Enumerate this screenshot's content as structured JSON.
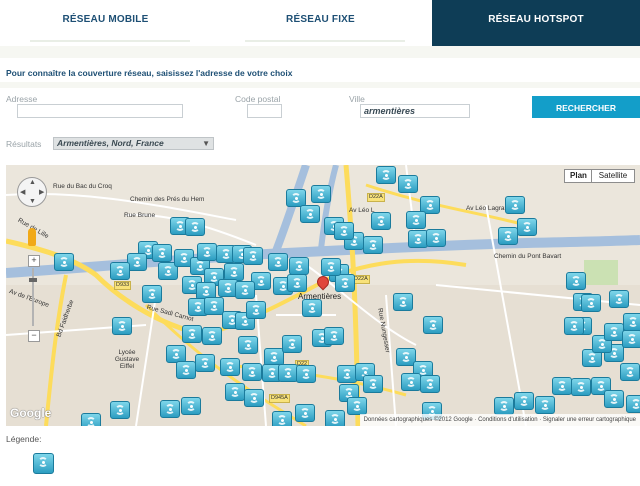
{
  "tabs": [
    {
      "label": "RÉSEAU MOBILE",
      "active": false
    },
    {
      "label": "RÉSEAU FIXE",
      "active": false
    },
    {
      "label": "RÉSEAU HOTSPOT",
      "active": true
    }
  ],
  "intro": "Pour connaître la couverture réseau, saisissez l'adresse de votre choix",
  "form": {
    "address_label": "Adresse",
    "address_value": "",
    "postal_label": "Code postal",
    "postal_value": "",
    "city_label": "Ville",
    "city_value": "armentières",
    "search_button": "RECHERCHER"
  },
  "results": {
    "label": "Résultats",
    "selected": "Armentières, Nord, France"
  },
  "map": {
    "type_buttons": [
      "Plan",
      "Satellite"
    ],
    "selected_type": "Plan",
    "city_label": "Armentières",
    "logo": "Google",
    "attribution": "Données cartographiques ©2012 Google · Conditions d'utilisation · Signaler une erreur cartographique",
    "road_labels": [
      "Rue du Bac du Croq",
      "Chemin des Prés du Hem",
      "Av Léo L",
      "Av Léo Lagrange",
      "Chemin du Pont Bavart",
      "Rue de Lille",
      "Rue Brune",
      "Av de l'Europe",
      "Lycée Gustave Eiffel",
      "Bd Faidherbe",
      "Rue Nungesser",
      "Rue Sadi Carnot"
    ],
    "road_badges": [
      "D22A",
      "D22A",
      "D933",
      "D22",
      "D945A"
    ],
    "colors": {
      "land": "#ebe6dc",
      "water": "#a5bfdd",
      "major_road": "#fddc5b",
      "park": "#cbe1b3",
      "hotspot": "#2c9dc1"
    }
  },
  "legend": {
    "label": "Légende:",
    "icon": "hotspot-icon"
  }
}
